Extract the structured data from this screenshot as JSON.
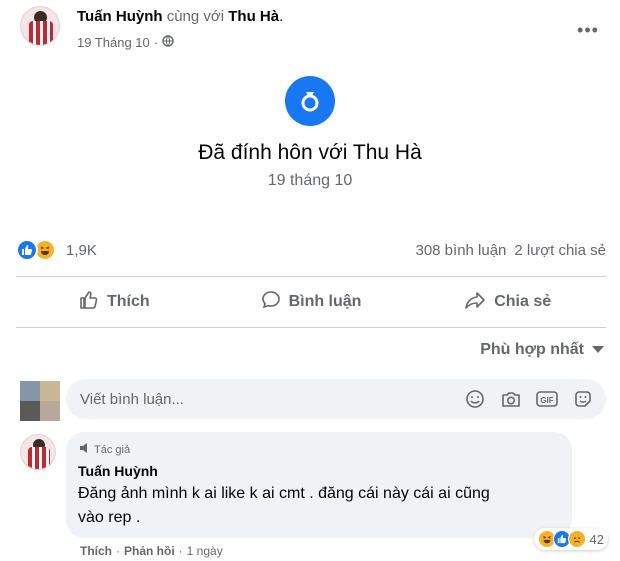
{
  "post": {
    "author": "Tuấn Huỳnh",
    "with_text": "cùng với",
    "tagged": "Thu Hà",
    "tagged_suffix": ".",
    "date": "19 Tháng 10",
    "dot": "·",
    "privacy_icon": "globe-icon"
  },
  "event": {
    "icon": "ring-icon",
    "title": "Đã đính hôn với Thu Hà",
    "date": "19 tháng 10"
  },
  "reactions": {
    "icons": [
      "like-icon",
      "haha-icon"
    ],
    "count": "1,9K",
    "comments": "308 bình luận",
    "shares": "2 lượt chia sẻ"
  },
  "actions": {
    "like": "Thích",
    "comment": "Bình luận",
    "share": "Chia sẻ"
  },
  "sort": {
    "label": "Phù hợp nhất"
  },
  "composer": {
    "placeholder": "Viết bình luận...",
    "tools": [
      "emoji-icon",
      "camera-icon",
      "gif-icon",
      "sticker-icon"
    ]
  },
  "comment": {
    "badge": "Tác giả",
    "author": "Tuấn Huỳnh",
    "text": "Đăng ảnh mình k ai like k ai cmt . đăng cái này cái ai cũng vào rep .",
    "reaction_count": "42",
    "like": "Thích",
    "reply": "Phản hồi",
    "time": "1 ngày",
    "sep": "·"
  },
  "colors": {
    "accent": "#1877f2",
    "muted": "#65676b",
    "bubble": "#f0f2f5"
  }
}
